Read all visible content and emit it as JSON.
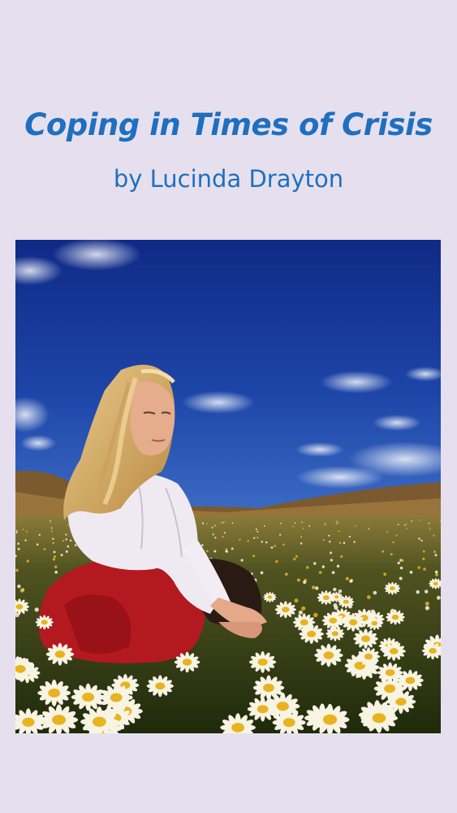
{
  "book": {
    "title": "Coping in Times of Crisis",
    "author_line": "by Lucinda Drayton"
  },
  "colors": {
    "background": "#e6e0ee",
    "title_text": "#1f6fc0",
    "sky": "#1c3f9e",
    "field": "#3c4a1a",
    "daisy": "#f8f4e4",
    "daisy_center": "#e8b31e"
  },
  "cover_image": {
    "subject": "woman-sitting-in-daisy-field"
  }
}
